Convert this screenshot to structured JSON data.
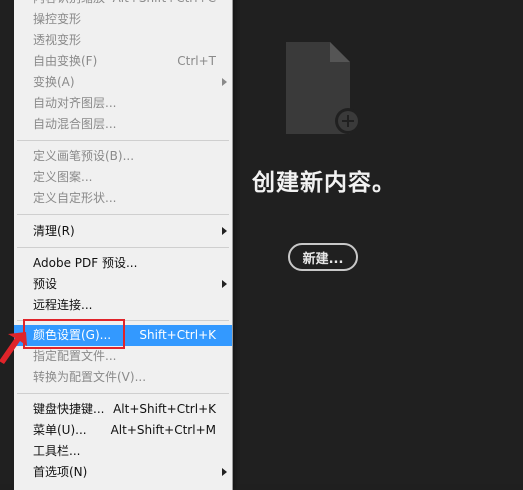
{
  "main": {
    "create_title": "创建新内容。",
    "new_button": "新建..."
  },
  "menu": {
    "items": [
      {
        "label": "内容识别缩放",
        "shortcut": "Alt+Shift+Ctrl+C",
        "enabled": false
      },
      {
        "label": "操控变形",
        "shortcut": "",
        "enabled": false
      },
      {
        "label": "透视变形",
        "shortcut": "",
        "enabled": false
      },
      {
        "label": "自由变换(F)",
        "shortcut": "Ctrl+T",
        "enabled": false
      },
      {
        "label": "变换(A)",
        "shortcut": "",
        "enabled": false,
        "submenu": true
      },
      {
        "label": "自动对齐图层...",
        "shortcut": "",
        "enabled": false
      },
      {
        "label": "自动混合图层...",
        "shortcut": "",
        "enabled": false
      },
      {
        "label": "定义画笔预设(B)...",
        "shortcut": "",
        "enabled": false
      },
      {
        "label": "定义图案...",
        "shortcut": "",
        "enabled": false
      },
      {
        "label": "定义自定形状...",
        "shortcut": "",
        "enabled": false
      },
      {
        "label": "清理(R)",
        "shortcut": "",
        "enabled": true,
        "submenu": true
      },
      {
        "label": "Adobe PDF 预设...",
        "shortcut": "",
        "enabled": true
      },
      {
        "label": "预设",
        "shortcut": "",
        "enabled": true,
        "submenu": true
      },
      {
        "label": "远程连接...",
        "shortcut": "",
        "enabled": true
      },
      {
        "label": "颜色设置(G)...",
        "shortcut": "Shift+Ctrl+K",
        "enabled": true,
        "highlighted": true
      },
      {
        "label": "指定配置文件...",
        "shortcut": "",
        "enabled": false
      },
      {
        "label": "转换为配置文件(V)...",
        "shortcut": "",
        "enabled": false
      },
      {
        "label": "键盘快捷键...",
        "shortcut": "Alt+Shift+Ctrl+K",
        "enabled": true
      },
      {
        "label": "菜单(U)...",
        "shortcut": "Alt+Shift+Ctrl+M",
        "enabled": true
      },
      {
        "label": "工具栏...",
        "shortcut": "",
        "enabled": true
      },
      {
        "label": "首选项(N)",
        "shortcut": "",
        "enabled": true,
        "submenu": true
      }
    ]
  },
  "colors": {
    "highlight": "#3399ff",
    "annotation": "#e0242a",
    "background": "#202020"
  }
}
